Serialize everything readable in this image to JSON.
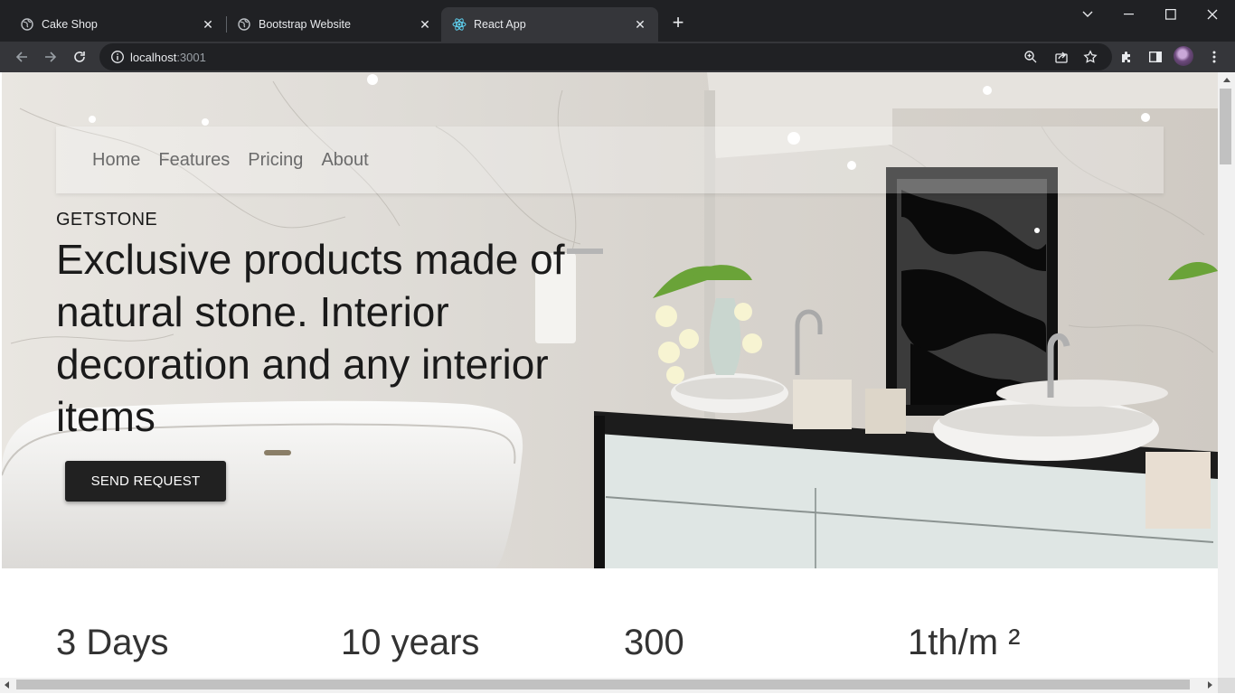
{
  "browser": {
    "tabs": [
      {
        "title": "Cake Shop",
        "icon": "globe-icon",
        "active": false
      },
      {
        "title": "Bootstrap Website",
        "icon": "globe-icon",
        "active": false
      },
      {
        "title": "React App",
        "icon": "react-icon",
        "active": true
      }
    ],
    "url_host": "localhost",
    "url_port": ":3001"
  },
  "site": {
    "nav": [
      "Home",
      "Features",
      "Pricing",
      "About"
    ],
    "brand": "GETSTONE",
    "headline": "Exclusive products made of natural stone. Interior decoration and any interior items",
    "cta_label": "SEND REQUEST",
    "stats": [
      "3 Days",
      "10 years",
      "300",
      "1th/m ²"
    ]
  },
  "colors": {
    "chrome_dark": "#202124",
    "chrome_toolbar": "#35363a",
    "button_bg": "#212121",
    "hero_marble": "#e3e0db"
  }
}
